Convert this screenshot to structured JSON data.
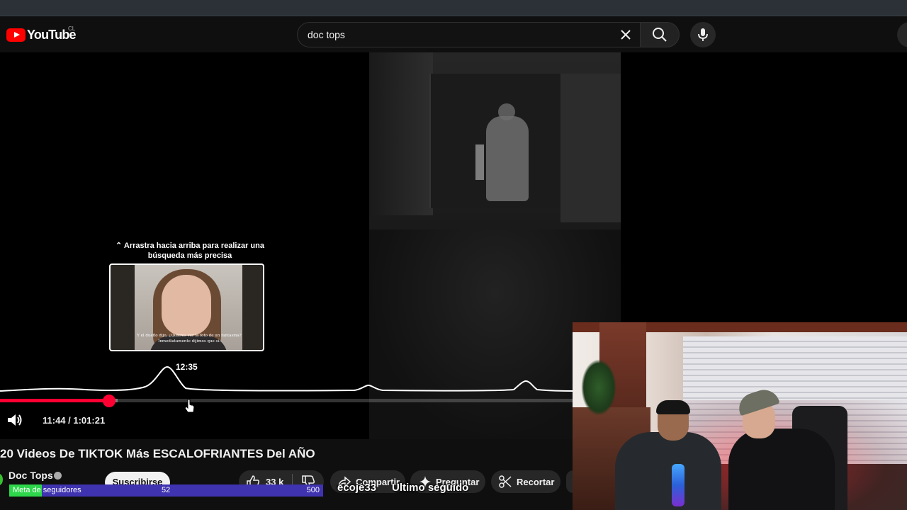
{
  "header": {
    "logo_text": "YouTube",
    "country_code": "CL"
  },
  "search": {
    "query": "doc tops"
  },
  "player": {
    "drag_hint": "⌃ Arrastra hacia arriba para realizar una búsqueda más precisa",
    "preview_caption": "Y el dueño dijo, ¿Quieres ver la foto de un fantasma? Inmediatamente dijimos que sí.",
    "hover_time": "12:35",
    "time_display": "11:44 / 1:01:21",
    "played_fraction": 0.191,
    "buffered_fraction": 0.205
  },
  "video": {
    "title": "20 Videos De TIKTOK Más ESCALOFRIANTES Del AÑO"
  },
  "channel": {
    "name": "Doc Tops",
    "subscribe_label": "Suscribirse"
  },
  "actions": {
    "likes": "33 k",
    "share_label": "Compartir",
    "ask_label": "Preguntar",
    "clip_label": "Recortar"
  },
  "follower_goal": {
    "label": "Meta de seguidores",
    "current": "52",
    "target": "500",
    "fraction": 0.104
  },
  "stream_overlay": {
    "last_follower_user": "ecoje33",
    "last_follower_label": "Ultimo seguido"
  },
  "colors": {
    "accent_red": "#ff0033",
    "goal_green": "#2dd64a",
    "goal_blue": "#3f33b0"
  },
  "icons": [
    "youtube-logo-icon",
    "clear-icon",
    "search-icon",
    "mic-icon",
    "volume-icon",
    "verified-icon",
    "like-icon",
    "dislike-icon",
    "share-icon",
    "sparkle-icon",
    "scissors-icon",
    "cursor-icon"
  ]
}
